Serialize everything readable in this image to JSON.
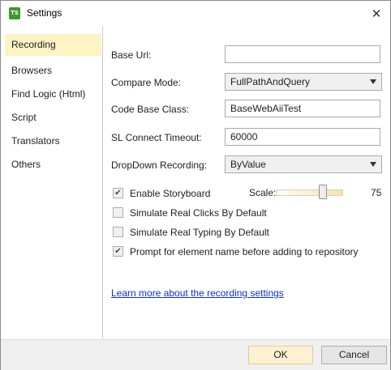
{
  "window": {
    "title": "Settings",
    "app_icon_text": "TS"
  },
  "sidebar": {
    "items": [
      {
        "label": "Recording",
        "active": true
      },
      {
        "label": "Browsers"
      },
      {
        "label": "Find Logic (Html)"
      },
      {
        "label": "Script"
      },
      {
        "label": "Translators"
      },
      {
        "label": "Others"
      }
    ]
  },
  "form": {
    "base_url": {
      "label": "Base Url:",
      "value": ""
    },
    "compare_mode": {
      "label": "Compare Mode:",
      "value": "FullPathAndQuery"
    },
    "code_base_class": {
      "label": "Code Base Class:",
      "value": "BaseWebAiiTest"
    },
    "sl_connect_timeout": {
      "label": "SL Connect Timeout:",
      "value": "60000"
    },
    "dropdown_recording": {
      "label": "DropDown Recording:",
      "value": "ByValue"
    }
  },
  "checkboxes": {
    "enable_storyboard": {
      "label": "Enable Storyboard",
      "checked": true,
      "mark": "✔"
    },
    "simulate_clicks": {
      "label": "Simulate Real Clicks By Default",
      "checked": false,
      "mark": ""
    },
    "simulate_typing": {
      "label": "Simulate Real Typing By Default",
      "checked": false,
      "mark": ""
    },
    "prompt_element_name": {
      "label": "Prompt for element name before adding to repository",
      "checked": true,
      "mark": "✔"
    }
  },
  "scale": {
    "label": "Scale:",
    "value": "75"
  },
  "link": {
    "text": "Learn more about the recording settings"
  },
  "buttons": {
    "ok": "OK",
    "cancel": "Cancel"
  },
  "colors": {
    "selected_item_bg": "#fdf3c4",
    "ok_button_bg": "#fcf2d3",
    "link": "#0b33c9",
    "app_icon": "#3e9a2e"
  },
  "icons": {
    "close": "close-icon",
    "app": "telerik-test-studio-icon",
    "dropdown": "chevron-down-icon",
    "check": "check-icon"
  }
}
